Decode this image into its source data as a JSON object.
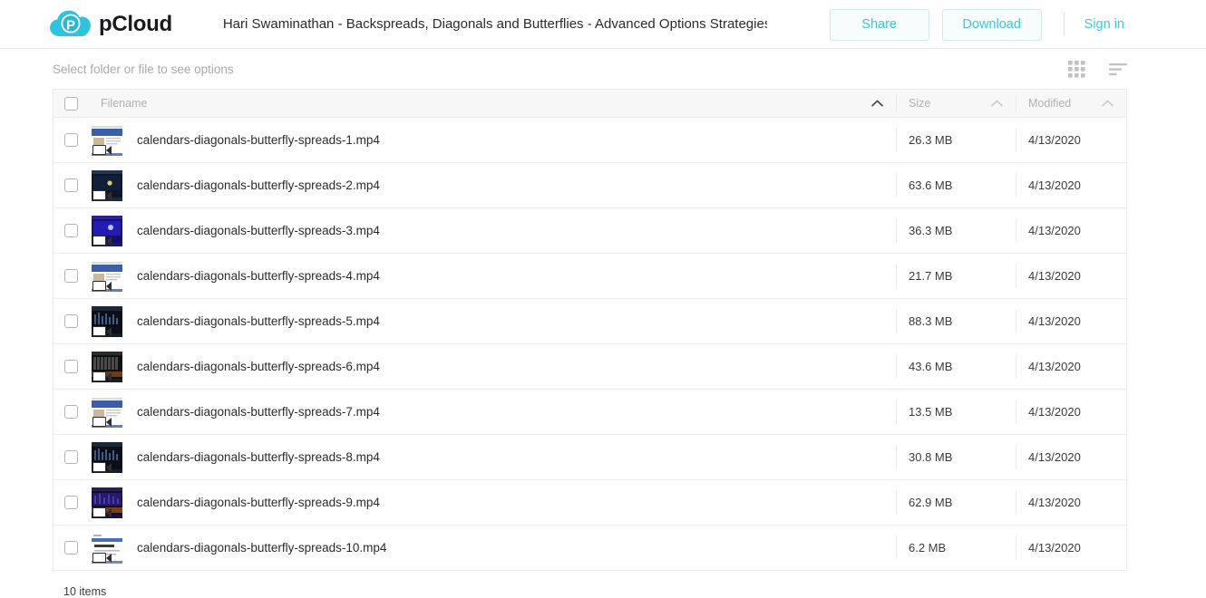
{
  "header": {
    "brand": "pCloud",
    "logo_icon": "pcloud-cloud-logo",
    "document_title": "Hari Swaminathan - Backspreads, Diagonals and Butterflies - Advanced Options Strategies - …",
    "share_label": "Share",
    "download_label": "Download",
    "signin_label": "Sign in",
    "accent_color": "#41c5d6"
  },
  "toolbar": {
    "hint": "Select folder or file to see options",
    "grid_view_icon": "grid-view-icon",
    "sort_icon": "sort-list-icon"
  },
  "table": {
    "columns": {
      "filename": "Filename",
      "size": "Size",
      "modified": "Modified"
    },
    "sort_caret_icon": "chevron-up-icon",
    "rows": [
      {
        "filename": "calendars-diagonals-butterfly-spreads-1.mp4",
        "size": "26.3 MB",
        "modified": "4/13/2020",
        "thumb": "light-doc"
      },
      {
        "filename": "calendars-diagonals-butterfly-spreads-2.mp4",
        "size": "63.6 MB",
        "modified": "4/13/2020",
        "thumb": "dark-navy"
      },
      {
        "filename": "calendars-diagonals-butterfly-spreads-3.mp4",
        "size": "36.3 MB",
        "modified": "4/13/2020",
        "thumb": "bright-blue"
      },
      {
        "filename": "calendars-diagonals-butterfly-spreads-4.mp4",
        "size": "21.7 MB",
        "modified": "4/13/2020",
        "thumb": "light-doc"
      },
      {
        "filename": "calendars-diagonals-butterfly-spreads-5.mp4",
        "size": "88.3 MB",
        "modified": "4/13/2020",
        "thumb": "dark-chart"
      },
      {
        "filename": "calendars-diagonals-butterfly-spreads-6.mp4",
        "size": "43.6 MB",
        "modified": "4/13/2020",
        "thumb": "dark-grid"
      },
      {
        "filename": "calendars-diagonals-butterfly-spreads-7.mp4",
        "size": "13.5 MB",
        "modified": "4/13/2020",
        "thumb": "light-doc"
      },
      {
        "filename": "calendars-diagonals-butterfly-spreads-8.mp4",
        "size": "30.8 MB",
        "modified": "4/13/2020",
        "thumb": "dark-chart"
      },
      {
        "filename": "calendars-diagonals-butterfly-spreads-9.mp4",
        "size": "62.9 MB",
        "modified": "4/13/2020",
        "thumb": "purple-chart"
      },
      {
        "filename": "calendars-diagonals-butterfly-spreads-10.mp4",
        "size": "6.2 MB",
        "modified": "4/13/2020",
        "thumb": "light-text"
      }
    ]
  },
  "footer": {
    "item_count": "10 items"
  }
}
